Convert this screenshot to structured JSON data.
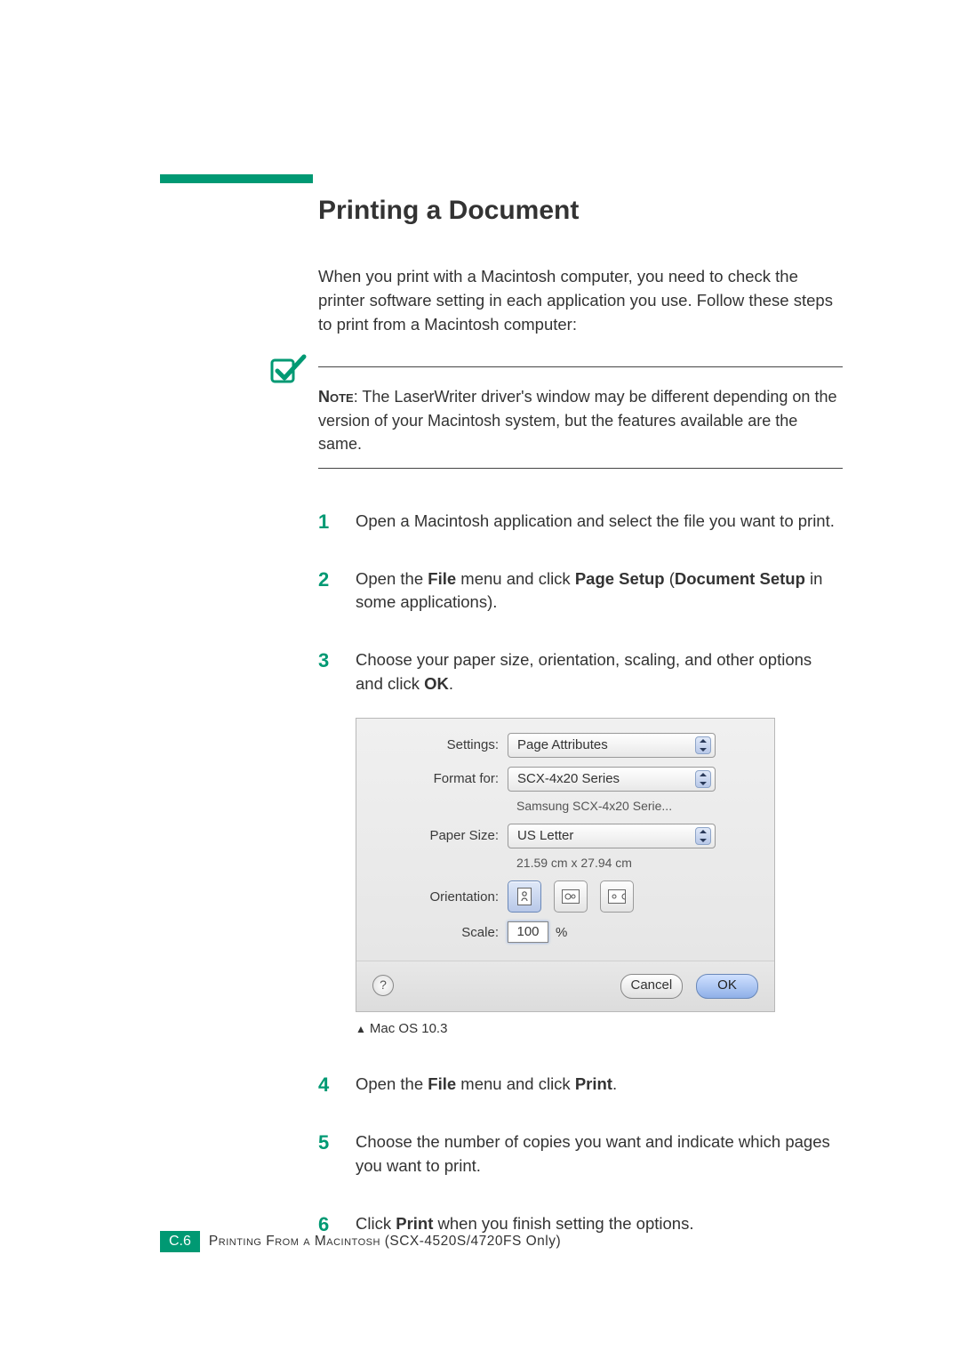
{
  "title": "Printing a Document",
  "intro": "When you print with a Macintosh computer, you need to check the printer software setting in each application you use. Follow these steps to print from a Macintosh computer:",
  "note": {
    "label": "Note",
    "body": ": The LaserWriter driver's window may be different depending on the version of your Macintosh system, but the features available are the same."
  },
  "steps": {
    "s1": "Open a Macintosh application and select the file you want to print.",
    "s2a": "Open the ",
    "s2b": "File",
    "s2c": " menu and click ",
    "s2d": "Page Setup",
    "s2e": " (",
    "s2f": "Document Setup",
    "s2g": " in some applications).",
    "s3a": "Choose your paper size, orientation, scaling, and other options and click ",
    "s3b": "OK",
    "s3c": ".",
    "s4a": "Open the ",
    "s4b": "File",
    "s4c": " menu and click ",
    "s4d": "Print",
    "s4e": ".",
    "s5": "Choose the number of copies you want and indicate which pages you want to print.",
    "s6a": "Click ",
    "s6b": "Print",
    "s6c": " when you finish setting the options."
  },
  "dialog": {
    "labels": {
      "settings": "Settings:",
      "format_for": "Format for:",
      "paper_size": "Paper Size:",
      "orientation": "Orientation:",
      "scale": "Scale:"
    },
    "values": {
      "settings": "Page Attributes",
      "format_for": "SCX-4x20 Series",
      "format_sub": "Samsung SCX-4x20 Serie...",
      "paper_size": "US Letter",
      "paper_sub": "21.59 cm x 27.94 cm",
      "scale": "100",
      "scale_unit": "%"
    },
    "buttons": {
      "help": "?",
      "cancel": "Cancel",
      "ok": "OK"
    }
  },
  "caption": "Mac OS 10.3",
  "footer": {
    "badge": "C.6",
    "text_a": "Printing From a Macintosh",
    "text_b": " (SCX-4520S/4720FS Only)"
  },
  "chart_data": {
    "type": "table",
    "title": "Mac OS 10.3 Page Setup dialog values",
    "rows": [
      {
        "field": "Settings",
        "value": "Page Attributes"
      },
      {
        "field": "Format for",
        "value": "SCX-4x20 Series"
      },
      {
        "field": "Format for (subtitle)",
        "value": "Samsung SCX-4x20 Serie..."
      },
      {
        "field": "Paper Size",
        "value": "US Letter"
      },
      {
        "field": "Paper Size (dimensions)",
        "value": "21.59 cm x 27.94 cm"
      },
      {
        "field": "Orientation",
        "value": "Portrait (selected)"
      },
      {
        "field": "Scale",
        "value": "100 %"
      }
    ]
  }
}
